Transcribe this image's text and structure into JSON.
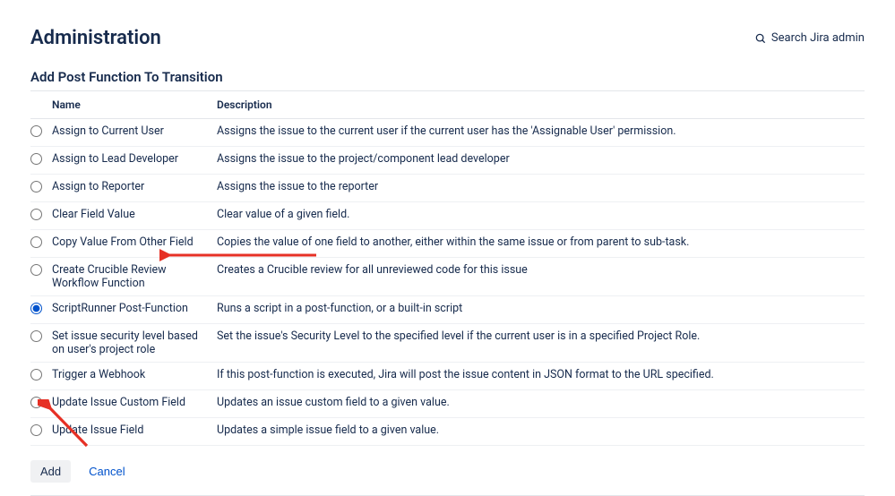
{
  "header": {
    "title": "Administration",
    "search_label": "Search Jira admin"
  },
  "section": {
    "title": "Add Post Function To Transition"
  },
  "table": {
    "headers": {
      "name": "Name",
      "description": "Description"
    },
    "rows": [
      {
        "name": "Assign to Current User",
        "desc": "Assigns the issue to the current user if the current user has the 'Assignable User' permission.",
        "selected": false
      },
      {
        "name": "Assign to Lead Developer",
        "desc": "Assigns the issue to the project/component lead developer",
        "selected": false
      },
      {
        "name": "Assign to Reporter",
        "desc": "Assigns the issue to the reporter",
        "selected": false
      },
      {
        "name": "Clear Field Value",
        "desc": "Clear value of a given field.",
        "selected": false
      },
      {
        "name": "Copy Value From Other Field",
        "desc": "Copies the value of one field to another, either within the same issue or from parent to sub-task.",
        "selected": false
      },
      {
        "name": "Create Crucible Review Workflow Function",
        "desc": "Creates a Crucible review for all unreviewed code for this issue",
        "selected": false
      },
      {
        "name": "ScriptRunner Post-Function",
        "desc": "Runs a script in a post-function, or a built-in script",
        "selected": true
      },
      {
        "name": "Set issue security level based on user's project role",
        "desc": "Set the issue's Security Level to the specified level if the current user is in a specified Project Role.",
        "selected": false
      },
      {
        "name": "Trigger a Webhook",
        "desc": "If this post-function is executed, Jira will post the issue content in JSON format to the URL specified.",
        "selected": false
      },
      {
        "name": "Update Issue Custom Field",
        "desc": "Updates an issue custom field to a given value.",
        "selected": false
      },
      {
        "name": "Update Issue Field",
        "desc": "Updates a simple issue field to a given value.",
        "selected": false
      }
    ]
  },
  "buttons": {
    "add": "Add",
    "cancel": "Cancel"
  }
}
